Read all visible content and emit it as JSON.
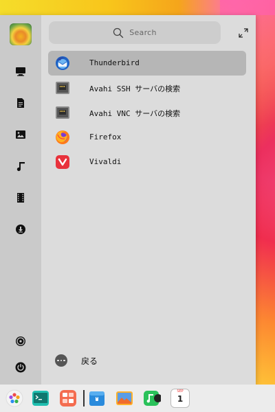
{
  "search": {
    "placeholder": "Search"
  },
  "apps": [
    {
      "name": "Thunderbird",
      "icon": "thunderbird-icon",
      "selected": true
    },
    {
      "name": "Avahi SSH サーバの検索",
      "icon": "network-server-icon",
      "selected": false
    },
    {
      "name": "Avahi VNC サーバの検索",
      "icon": "network-server-icon",
      "selected": false
    },
    {
      "name": "Firefox",
      "icon": "firefox-icon",
      "selected": false
    },
    {
      "name": "Vivaldi",
      "icon": "vivaldi-icon",
      "selected": false
    }
  ],
  "back_label": "戻る",
  "sidebar_icons": [
    "computer-icon",
    "documents-icon",
    "pictures-icon",
    "music-icon",
    "videos-icon",
    "downloads-icon",
    "settings-icon",
    "power-icon"
  ],
  "dock_icons": [
    "launcher-icon",
    "terminal-icon",
    "multitasking-icon",
    "file-manager-icon",
    "image-viewer-icon",
    "music-player-icon",
    "calendar-icon"
  ],
  "calendar": {
    "month": "SEP",
    "day": "1"
  },
  "colors": {
    "panel_bg": "#dcdcdc",
    "sidebar_bg": "#cacaca",
    "selected_row": "#b6b6b6",
    "dock_bg": "#ececec"
  }
}
